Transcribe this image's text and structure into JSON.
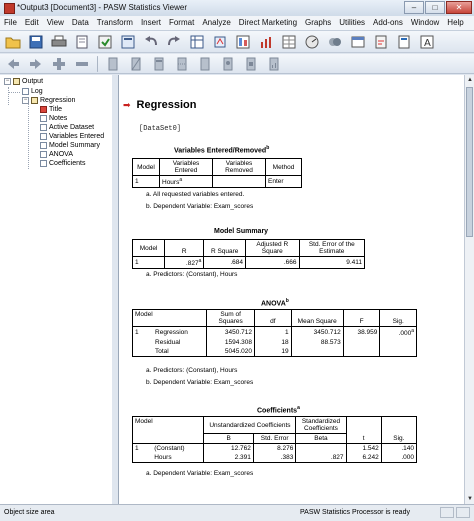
{
  "window": {
    "title": "*Output3 [Document3] - PASW Statistics Viewer",
    "btn_min": "–",
    "btn_max": "□",
    "btn_close": "✕"
  },
  "menu": [
    "File",
    "Edit",
    "View",
    "Data",
    "Transform",
    "Insert",
    "Format",
    "Analyze",
    "Direct Marketing",
    "Graphs",
    "Utilities",
    "Add-ons",
    "Window",
    "Help"
  ],
  "outline": {
    "output": "Output",
    "log": "Log",
    "regression": "Regression",
    "items": [
      "Title",
      "Notes",
      "Active Dataset",
      "Variables Entered",
      "Model Summary",
      "ANOVA",
      "Coefficients"
    ]
  },
  "content": {
    "heading": "Regression",
    "dataset": "[DataSet0]",
    "vars": {
      "title": "Variables Entered/Removed",
      "title_sup": "b",
      "h_model": "Model",
      "h_entered": "Variables Entered",
      "h_removed": "Variables Removed",
      "h_method": "Method",
      "row_model": "1",
      "row_entered": "Hours",
      "row_entered_sup": "a",
      "row_removed": "",
      "row_method": "Enter",
      "note_a": "a. All requested variables entered.",
      "note_b": "b. Dependent Variable: Exam_scores"
    },
    "summary": {
      "title": "Model Summary",
      "h_model": "Model",
      "h_r": "R",
      "h_rsq": "R Square",
      "h_adj": "Adjusted R Square",
      "h_se": "Std. Error of the Estimate",
      "row_model": "1",
      "row_r": ".827",
      "row_r_sup": "a",
      "row_rsq": ".684",
      "row_adj": ".666",
      "row_se": "9.411",
      "note_a": "a. Predictors: (Constant), Hours"
    },
    "anova": {
      "title": "ANOVA",
      "title_sup": "b",
      "h_model": "Model",
      "h_ss": "Sum of Squares",
      "h_df": "df",
      "h_ms": "Mean Square",
      "h_f": "F",
      "h_sig": "Sig.",
      "row_model": "1",
      "rows": [
        {
          "label": "Regression",
          "ss": "3450.712",
          "df": "1",
          "ms": "3450.712",
          "f": "38.959",
          "sig": ".000",
          "sig_sup": "a"
        },
        {
          "label": "Residual",
          "ss": "1594.308",
          "df": "18",
          "ms": "88.573",
          "f": "",
          "sig": "",
          "sig_sup": ""
        },
        {
          "label": "Total",
          "ss": "5045.020",
          "df": "19",
          "ms": "",
          "f": "",
          "sig": "",
          "sig_sup": ""
        }
      ],
      "note_a": "a. Predictors: (Constant), Hours",
      "note_b": "b. Dependent Variable: Exam_scores"
    },
    "coef": {
      "title": "Coefficients",
      "title_sup": "a",
      "h_model": "Model",
      "h_unstd": "Unstandardized Coefficients",
      "h_std": "Standardized Coefficients",
      "h_b": "B",
      "h_se": "Std. Error",
      "h_beta": "Beta",
      "h_t": "t",
      "h_sig": "Sig.",
      "row_model": "1",
      "rows": [
        {
          "label": "(Constant)",
          "b": "12.762",
          "se": "8.276",
          "beta": "",
          "t": "1.542",
          "sig": ".140"
        },
        {
          "label": "Hours",
          "b": "2.391",
          "se": ".383",
          "beta": ".827",
          "t": "6.242",
          "sig": ".000"
        }
      ],
      "note_a": "a. Dependent Variable: Exam_scores"
    }
  },
  "status": {
    "left": "Object size area",
    "right": "PASW Statistics Processor is ready"
  },
  "colors": {
    "accent_red": "#c9211e",
    "window_bg": "#dfe6ef"
  }
}
